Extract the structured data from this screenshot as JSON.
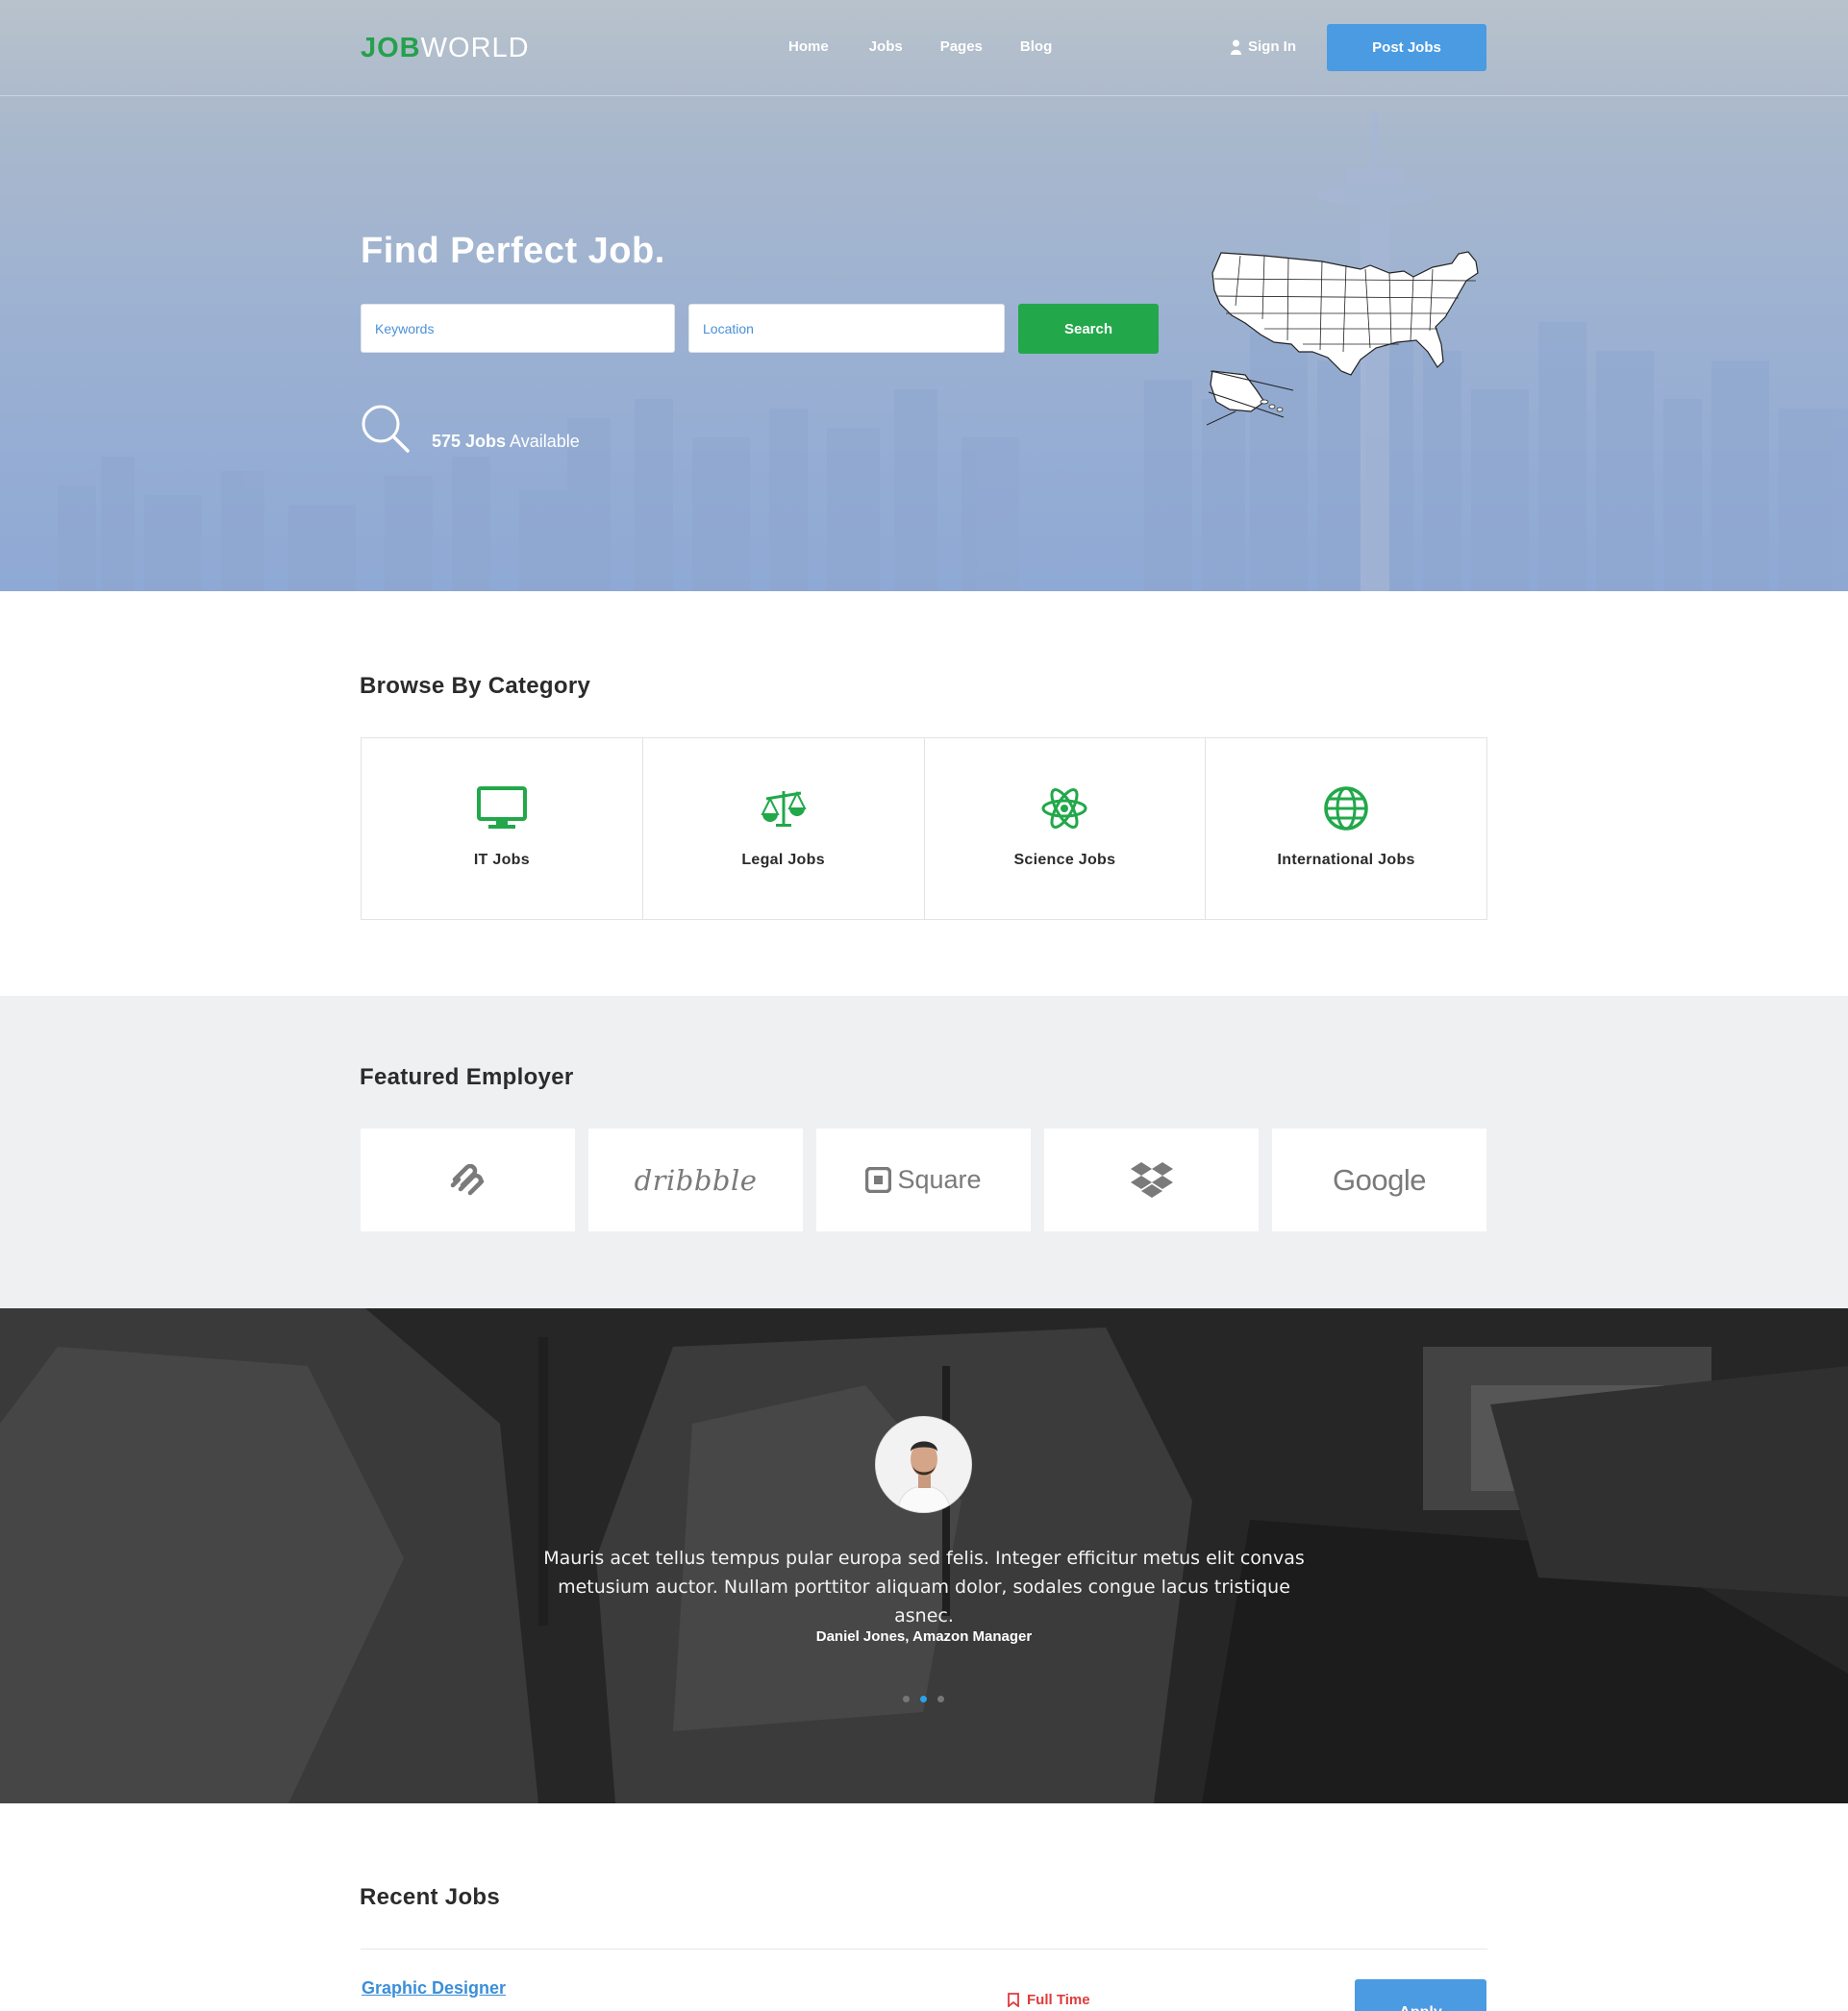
{
  "header": {
    "logo_job": "JOB",
    "logo_world": "WORLD",
    "nav": [
      "Home",
      "Jobs",
      "Pages",
      "Blog"
    ],
    "signin_label": "Sign In",
    "post_jobs_label": "Post Jobs"
  },
  "hero": {
    "title": "Find Perfect Job.",
    "keywords_placeholder": "Keywords",
    "location_placeholder": "Location",
    "search_label": "Search",
    "jobs_count": "575 Jobs",
    "jobs_suffix": " Available"
  },
  "categories": {
    "title": "Browse By Category",
    "items": [
      {
        "label": "IT Jobs",
        "icon": "monitor-icon"
      },
      {
        "label": "Legal Jobs",
        "icon": "scales-icon"
      },
      {
        "label": "Science Jobs",
        "icon": "atom-icon"
      },
      {
        "label": "International Jobs",
        "icon": "globe-icon"
      }
    ],
    "icon_color": "#22a84a"
  },
  "featured": {
    "title": "Featured Employer",
    "employers": [
      {
        "name": "squarespace",
        "icon": "squarespace-logo"
      },
      {
        "name": "dribbble",
        "text": "dribbble"
      },
      {
        "name": "square",
        "text": "Square"
      },
      {
        "name": "dropbox",
        "icon": "dropbox-logo"
      },
      {
        "name": "google",
        "text": "Google"
      }
    ]
  },
  "testimonial": {
    "quote": "Mauris acet tellus tempus pular europa sed felis. Integer efficitur metus elit convas metusium auctor. Nullam porttitor aliquam dolor, sodales congue lacus tristique asnec.",
    "author": "Daniel Jones, Amazon Manager",
    "slides_total": 3,
    "active_slide": 2
  },
  "recent": {
    "title": "Recent Jobs",
    "jobs": [
      {
        "title": "Graphic Designer",
        "type": "Full Time",
        "apply_label": "Apply"
      }
    ]
  },
  "colors": {
    "brand_green": "#22a84a",
    "accent_blue": "#4a9be2",
    "job_type_red": "#e03b3b"
  }
}
